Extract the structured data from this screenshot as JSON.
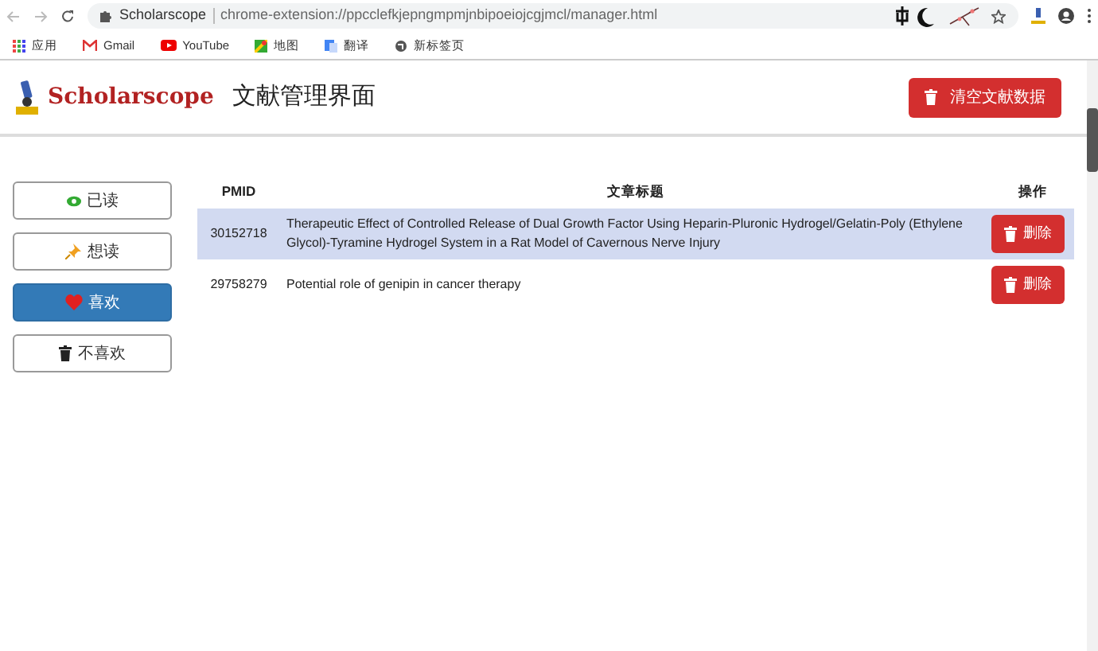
{
  "browser": {
    "tab_title": "Scholarscope",
    "url": "chrome-extension://ppcclefkjepngmpmjnbipoeiojcgjmcl/manager.html",
    "bookmarks": [
      {
        "label": "应用"
      },
      {
        "label": "Gmail"
      },
      {
        "label": "YouTube"
      },
      {
        "label": "地图"
      },
      {
        "label": "翻译"
      },
      {
        "label": "新标签页"
      }
    ]
  },
  "header": {
    "logo": "Scholarscope",
    "title": "文献管理界面",
    "clear_button": "清空文献数据"
  },
  "filters": [
    {
      "label": "已读",
      "selected": false
    },
    {
      "label": "想读",
      "selected": false
    },
    {
      "label": "喜欢",
      "selected": true
    },
    {
      "label": "不喜欢",
      "selected": false
    }
  ],
  "table": {
    "columns": [
      "PMID",
      "文章标题",
      "操作"
    ],
    "rows": [
      {
        "pmid": "30152718",
        "title": "Therapeutic Effect of Controlled Release of Dual Growth Factor Using Heparin-Pluronic Hydrogel/Gelatin-Poly (Ethylene Glycol)-Tyramine Hydrogel System in a Rat Model of Cavernous Nerve Injury",
        "action": "删除",
        "selected": true
      },
      {
        "pmid": "29758279",
        "title": "Potential role of genipin in cancer therapy",
        "action": "删除",
        "selected": false
      }
    ]
  }
}
